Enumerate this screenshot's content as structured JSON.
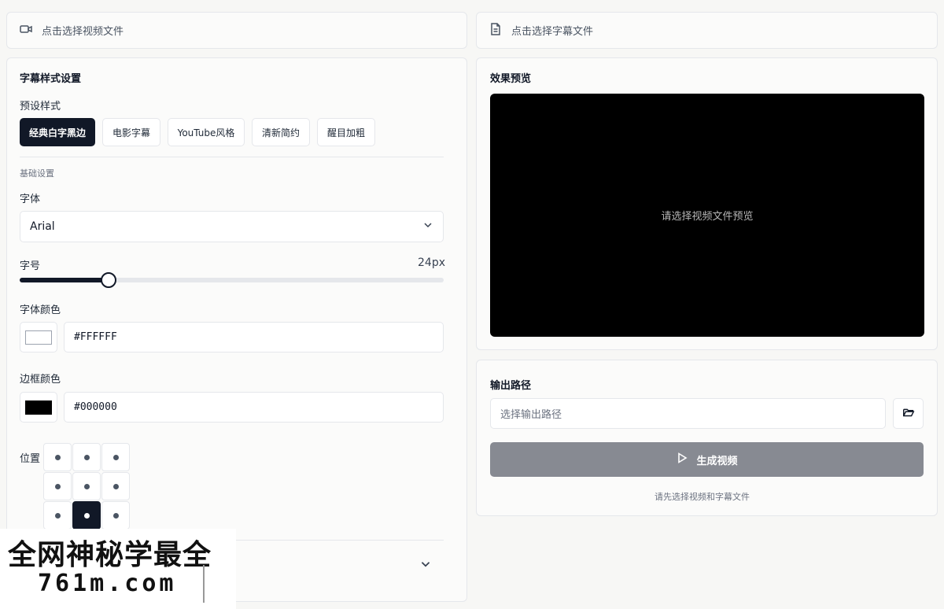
{
  "video_picker": {
    "label": "点击选择视频文件",
    "icon": "video-camera-icon"
  },
  "subtitle_picker": {
    "label": "点击选择字幕文件",
    "icon": "document-icon"
  },
  "style_panel": {
    "title": "字幕样式设置",
    "presets_label": "预设样式",
    "presets": [
      {
        "label": "经典白字黑边",
        "active": true
      },
      {
        "label": "电影字幕",
        "active": false
      },
      {
        "label": "YouTube风格",
        "active": false
      },
      {
        "label": "清新简约",
        "active": false
      },
      {
        "label": "醒目加粗",
        "active": false
      }
    ],
    "basic_label": "基础设置",
    "font_label": "字体",
    "font_value": "Arial",
    "size_label": "字号",
    "size_value": "24px",
    "size_slider_fraction": 0.21,
    "font_color_label": "字体颜色",
    "font_color_hex": "#FFFFFF",
    "outline_color_label": "边框颜色",
    "outline_color_hex": "#000000",
    "position_label": "位置",
    "position_selected": "bottom-center"
  },
  "preview_panel": {
    "title": "效果预览",
    "placeholder": "请选择视频文件预览"
  },
  "output_panel": {
    "title": "输出路径",
    "path_placeholder": "选择输出路径",
    "folder_icon": "folder-open-icon",
    "generate_label": "生成视频",
    "generate_icon": "play-icon",
    "hint": "请先选择视频和字幕文件"
  },
  "watermark": {
    "line1": "全网神秘学最全",
    "line2": "761m.com"
  }
}
